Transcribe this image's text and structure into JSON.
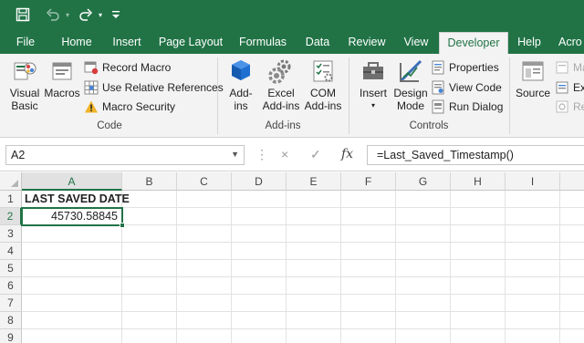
{
  "colors": {
    "brand": "#217346",
    "ribbon_bg": "#f3f3f3"
  },
  "qat": {
    "save_icon": "save-icon",
    "undo_icon": "undo-icon",
    "redo_icon": "redo-icon",
    "customize_icon": "customize-qat-icon"
  },
  "tabs": [
    "File",
    "Home",
    "Insert",
    "Page Layout",
    "Formulas",
    "Data",
    "Review",
    "View",
    "Developer",
    "Help",
    "Acro"
  ],
  "active_tab": "Developer",
  "ribbon": {
    "code": {
      "label": "Code",
      "visual_basic": "Visual\nBasic",
      "visual_basic_l1": "Visual",
      "visual_basic_l2": "Basic",
      "macros": "Macros",
      "record_macro": "Record Macro",
      "relative_refs": "Use Relative References",
      "macro_security": "Macro Security"
    },
    "addins": {
      "label": "Add-ins",
      "addins_l1": "Add-",
      "addins_l2": "ins",
      "excel_addins_l1": "Excel",
      "excel_addins_l2": "Add-ins",
      "com_addins_l1": "COM",
      "com_addins_l2": "Add-ins"
    },
    "controls": {
      "label": "Controls",
      "insert": "Insert",
      "design_mode_l1": "Design",
      "design_mode_l2": "Mode",
      "properties": "Properties",
      "view_code": "View Code",
      "run_dialog": "Run Dialog"
    },
    "xml": {
      "source": "Source",
      "map_props": "Ma",
      "expansion": "Exp",
      "refresh": "Ref"
    }
  },
  "formula_bar": {
    "name_box": "A2",
    "cancel_icon": "×",
    "enter_icon": "✓",
    "fx_label": "fx",
    "formula": "=Last_Saved_Timestamp()"
  },
  "sheet": {
    "columns": [
      "A",
      "B",
      "C",
      "D",
      "E",
      "F",
      "G",
      "H",
      "I"
    ],
    "rows": [
      "1",
      "2",
      "3",
      "4",
      "5",
      "6",
      "7",
      "8",
      "9"
    ],
    "cells": {
      "A1": "LAST SAVED DATE",
      "A2": "45730.58845"
    },
    "selected_cell": "A2"
  }
}
